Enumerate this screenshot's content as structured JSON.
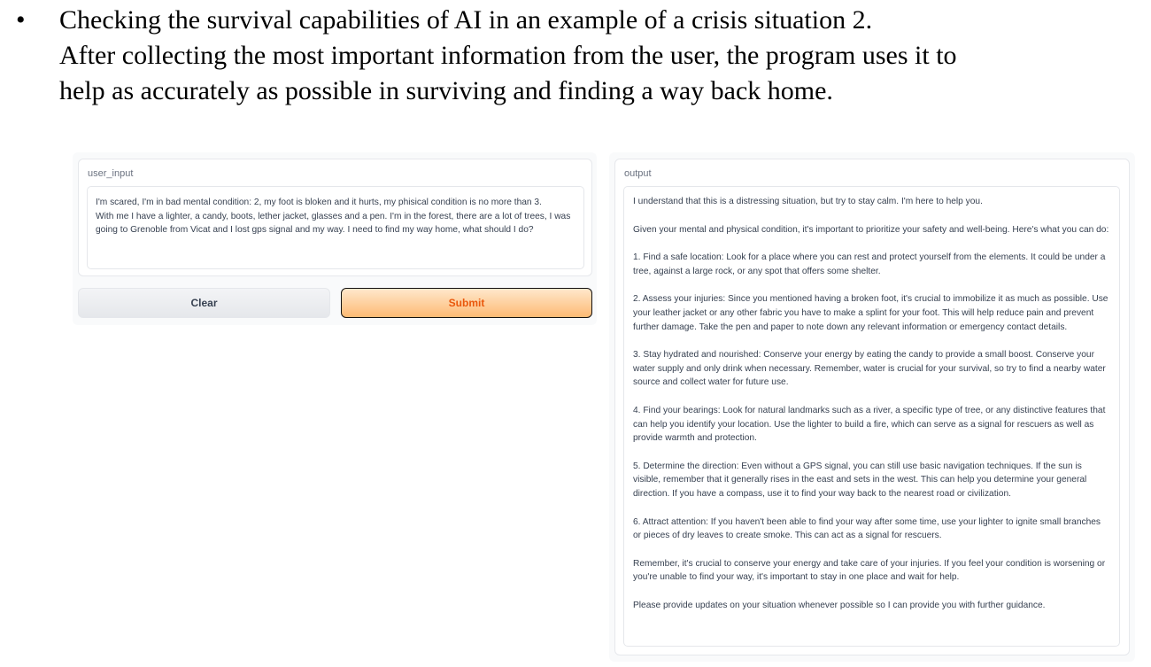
{
  "document": {
    "bullet": "•",
    "lines": [
      "Checking the survival capabilities of AI in an example of a crisis situation 2.",
      "After collecting the most important information from the user, the program uses it to",
      "help as accurately as possible in surviving and finding a way back home."
    ]
  },
  "input_panel": {
    "label": "user_input",
    "value": "I'm scared, I'm in bad mental condition: 2, my foot is bloken and it hurts, my phisical condition is no more than 3.\nWith me I have a lighter, a candy, boots, lether jacket, glasses and a pen. I'm in the forest, there are a lot of trees, I was going to Grenoble from Vicat and I lost gps signal and my way. I need to find my way home, what should I do?"
  },
  "buttons": {
    "clear_label": "Clear",
    "submit_label": "Submit"
  },
  "output_panel": {
    "label": "output",
    "paragraphs": [
      "I understand that this is a distressing situation, but try to stay calm. I'm here to help you.",
      "Given your mental and physical condition, it's important to prioritize your safety and well-being. Here's what you can do:",
      "1. Find a safe location: Look for a place where you can rest and protect yourself from the elements. It could be under a tree, against a large rock, or any spot that offers some shelter.",
      "2. Assess your injuries: Since you mentioned having a broken foot, it's crucial to immobilize it as much as possible. Use your leather jacket or any other fabric you have to make a splint for your foot. This will help reduce pain and prevent further damage. Take the pen and paper to note down any relevant information or emergency contact details.",
      "3. Stay hydrated and nourished: Conserve your energy by eating the candy to provide a small boost. Conserve your water supply and only drink when necessary. Remember, water is crucial for your survival, so try to find a nearby water source and collect water for future use.",
      "4. Find your bearings: Look for natural landmarks such as a river, a specific type of tree, or any distinctive features that can help you identify your location. Use the lighter to build a fire, which can serve as a signal for rescuers as well as provide warmth and protection.",
      "5. Determine the direction: Even without a GPS signal, you can still use basic navigation techniques. If the sun is visible, remember that it generally rises in the east and sets in the west. This can help you determine your general direction. If you have a compass, use it to find your way back to the nearest road or civilization.",
      "6. Attract attention: If you haven't been able to find your way after some time, use your lighter to ignite small branches or pieces of dry leaves to create smoke. This can act as a signal for rescuers.",
      "Remember, it's crucial to conserve your energy and take care of your injuries. If you feel your condition is worsening or you're unable to find your way, it's important to stay in one place and wait for help.",
      "Please provide updates on your situation whenever possible so I can provide you with further guidance."
    ]
  }
}
